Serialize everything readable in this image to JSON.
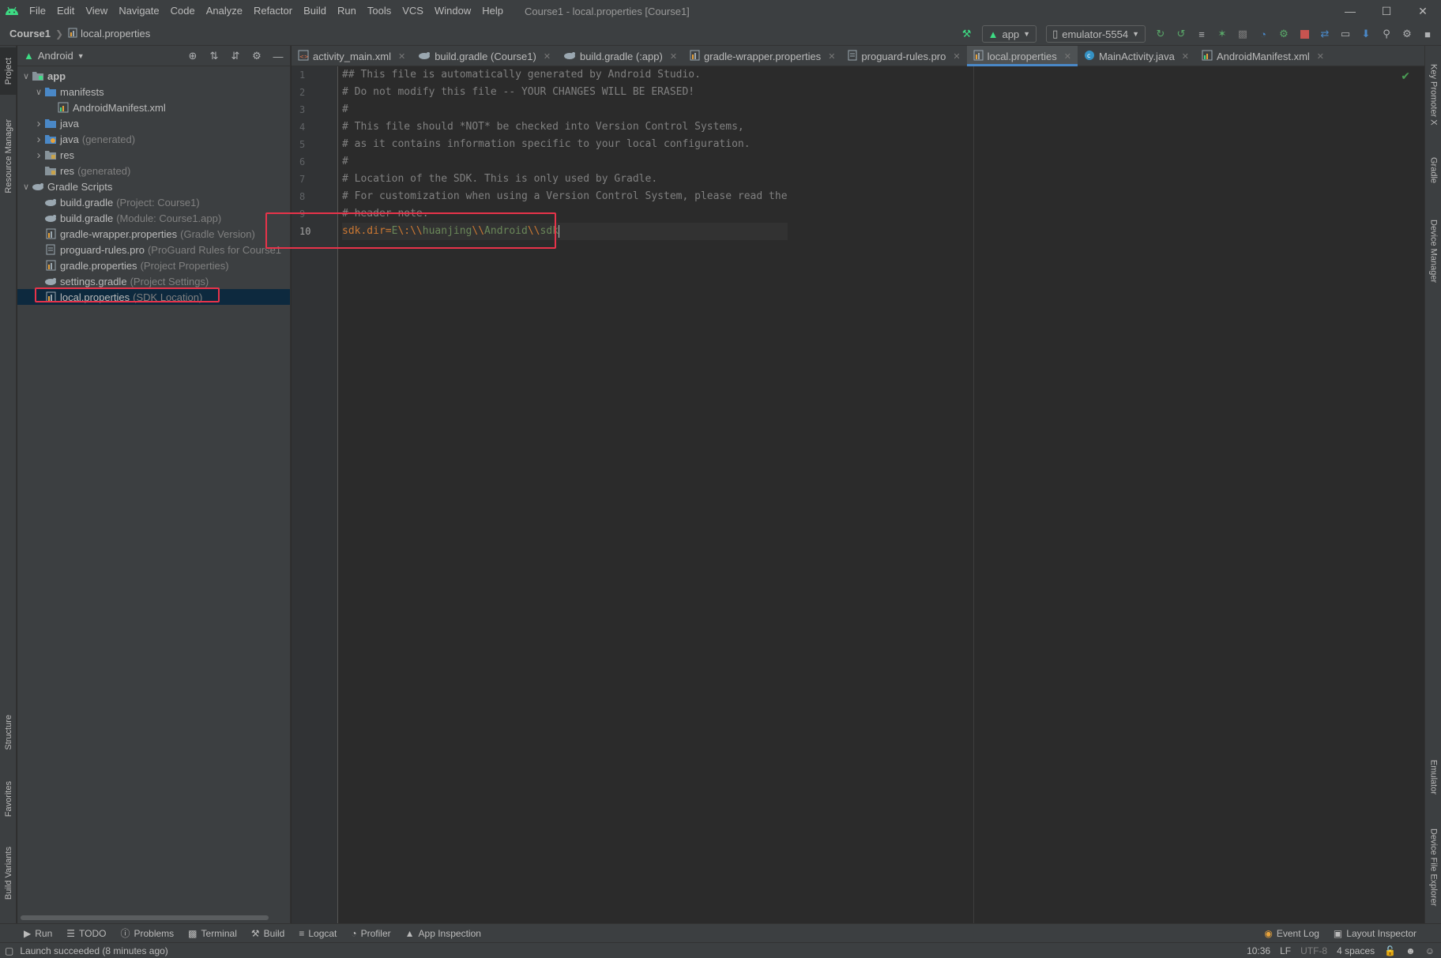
{
  "menubar": {
    "items": [
      "File",
      "Edit",
      "View",
      "Navigate",
      "Code",
      "Analyze",
      "Refactor",
      "Build",
      "Run",
      "Tools",
      "VCS",
      "Window",
      "Help"
    ],
    "window_title": "Course1 - local.properties [Course1]"
  },
  "navbar": {
    "project": "Course1",
    "file": "local.properties",
    "run_config": "app",
    "device": "emulator-5554"
  },
  "left_strip": {
    "project": "Project",
    "resource_manager": "Resource Manager",
    "structure": "Structure",
    "favorites": "Favorites",
    "build_variants": "Build Variants"
  },
  "right_strip": {
    "key_promoter": "Key Promoter X",
    "gradle": "Gradle",
    "device_manager": "Device Manager",
    "emulator": "Emulator",
    "device_file_explorer": "Device File Explorer"
  },
  "project_panel": {
    "view_mode": "Android",
    "tree": [
      {
        "label": "app",
        "hint": "",
        "level": 0,
        "arrow": "down",
        "icon": "folder-module"
      },
      {
        "label": "manifests",
        "hint": "",
        "level": 1,
        "arrow": "down",
        "icon": "folder"
      },
      {
        "label": "AndroidManifest.xml",
        "hint": "",
        "level": 2,
        "arrow": "",
        "icon": "manifest"
      },
      {
        "label": "java",
        "hint": "",
        "level": 1,
        "arrow": "right",
        "icon": "folder"
      },
      {
        "label": "java",
        "hint": "(generated)",
        "level": 1,
        "arrow": "right",
        "icon": "folder-gen"
      },
      {
        "label": "res",
        "hint": "",
        "level": 1,
        "arrow": "right",
        "icon": "folder-res"
      },
      {
        "label": "res",
        "hint": "(generated)",
        "level": 1,
        "arrow": "",
        "icon": "folder-res"
      },
      {
        "label": "Gradle Scripts",
        "hint": "",
        "level": 0,
        "arrow": "down",
        "icon": "gradle"
      },
      {
        "label": "build.gradle",
        "hint": "(Project: Course1)",
        "level": 1,
        "arrow": "",
        "icon": "gradle"
      },
      {
        "label": "build.gradle",
        "hint": "(Module: Course1.app)",
        "level": 1,
        "arrow": "",
        "icon": "gradle"
      },
      {
        "label": "gradle-wrapper.properties",
        "hint": "(Gradle Version)",
        "level": 1,
        "arrow": "",
        "icon": "properties"
      },
      {
        "label": "proguard-rules.pro",
        "hint": "(ProGuard Rules for Course1",
        "level": 1,
        "arrow": "",
        "icon": "text"
      },
      {
        "label": "gradle.properties",
        "hint": "(Project Properties)",
        "level": 1,
        "arrow": "",
        "icon": "properties"
      },
      {
        "label": "settings.gradle",
        "hint": "(Project Settings)",
        "level": 1,
        "arrow": "",
        "icon": "gradle"
      },
      {
        "label": "local.properties",
        "hint": "(SDK Location)",
        "level": 1,
        "arrow": "",
        "icon": "properties",
        "selected": true
      }
    ]
  },
  "editor_tabs": [
    {
      "label": "activity_main.xml",
      "icon": "xml"
    },
    {
      "label": "build.gradle (Course1)",
      "icon": "gradle"
    },
    {
      "label": "build.gradle (:app)",
      "icon": "gradle"
    },
    {
      "label": "gradle-wrapper.properties",
      "icon": "properties"
    },
    {
      "label": "proguard-rules.pro",
      "icon": "text"
    },
    {
      "label": "local.properties",
      "icon": "properties",
      "active": true
    },
    {
      "label": "MainActivity.java",
      "icon": "class"
    },
    {
      "label": "AndroidManifest.xml",
      "icon": "manifest"
    }
  ],
  "editor": {
    "line_numbers": [
      "1",
      "2",
      "3",
      "4",
      "5",
      "6",
      "7",
      "8",
      "9",
      "10"
    ],
    "comment_lines": [
      "## This file is automatically generated by Android Studio.",
      "# Do not modify this file -- YOUR CHANGES WILL BE ERASED!",
      "#",
      "# This file should *NOT* be checked into Version Control Systems,",
      "# as it contains information specific to your local configuration.",
      "#",
      "# Location of the SDK. This is only used by Gradle.",
      "# For customization when using a Version Control System, please read the",
      "# header note."
    ],
    "property_line": {
      "key": "sdk.dir",
      "eq": "=",
      "value_parts": [
        "E",
        "\\:",
        "\\\\",
        "huanjing",
        "\\\\",
        "Android",
        "\\\\",
        "sdk"
      ]
    }
  },
  "bottom_bar": {
    "items": [
      "Run",
      "TODO",
      "Problems",
      "Terminal",
      "Build",
      "Logcat",
      "Profiler",
      "App Inspection"
    ],
    "right_items": [
      "Event Log",
      "Layout Inspector"
    ]
  },
  "status_bar": {
    "message": "Launch succeeded (8 minutes ago)",
    "time": "10:36",
    "line_sep": "LF",
    "encoding": "UTF-8",
    "indent": "4 spaces"
  },
  "colors": {
    "highlight_box": "#e8334a",
    "android_green": "#3ddc84",
    "selection": "#0d293e",
    "tab_accent": "#4a88c7"
  }
}
